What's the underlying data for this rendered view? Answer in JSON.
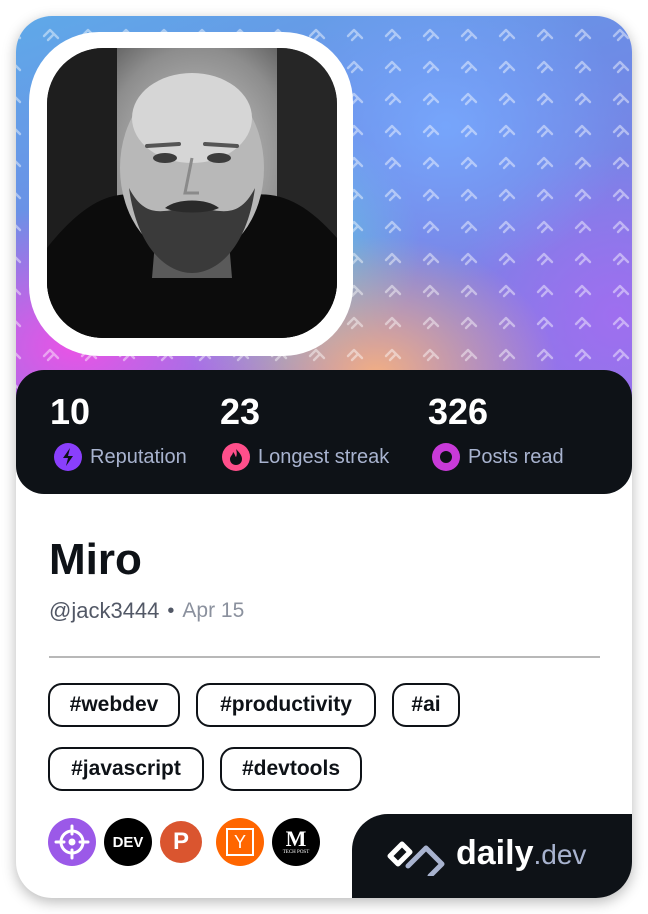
{
  "stats": [
    {
      "value": "10",
      "label": "Reputation",
      "icon": "lightning-icon",
      "color": "#8a3ffc"
    },
    {
      "value": "23",
      "label": "Longest streak",
      "icon": "flame-icon",
      "color": "#ff4f8b"
    },
    {
      "value": "326",
      "label": "Posts read",
      "icon": "eye-icon",
      "color": "#c83ad8"
    }
  ],
  "profile": {
    "name": "Miro",
    "handle": "@jack3444",
    "separator": "•",
    "joined": "Apr 15"
  },
  "tags": [
    "#webdev",
    "#productivity",
    "#ai",
    "#javascript",
    "#devtools"
  ],
  "sources": [
    {
      "name": "crosshair-source-icon",
      "bg": "#9b59e8",
      "text": ""
    },
    {
      "name": "dev-to-source-icon",
      "bg": "#000000",
      "text": "DEV"
    },
    {
      "name": "product-hunt-source-icon",
      "bg": "#da552f",
      "text": "P"
    },
    {
      "name": "hacker-news-source-icon",
      "bg": "#ff6600",
      "text": "Y"
    },
    {
      "name": "medium-techpost-source-icon",
      "bg": "#000000",
      "text": "M",
      "subtext": "TECH POST"
    }
  ],
  "brand": {
    "name": "daily",
    "tld": ".dev"
  }
}
